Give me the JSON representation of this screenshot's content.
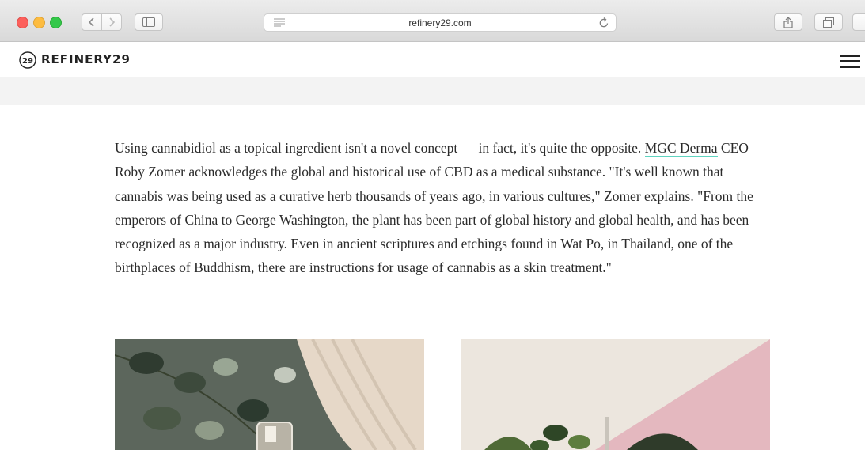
{
  "browser": {
    "url": "refinery29.com",
    "icons": [
      "back-icon",
      "forward-icon",
      "sidebar-icon",
      "reader-icon",
      "reload-icon",
      "share-icon",
      "tabs-icon"
    ]
  },
  "site": {
    "logo_text": "REFINERY29",
    "logo_mark_glyph": "29",
    "menu_icon": "hamburger-menu-icon"
  },
  "article": {
    "para_1a": "Using cannabidiol as a topical ingredient isn't a novel concept — in fact, it's quite the opposite.",
    "link_text": "MGC Derma",
    "para_1b": " CEO Roby Zomer acknowledges the global and historical use of CBD as a medical substance. \"It's well known that cannabis was being used as a curative herb thousands of years ago, in various cultures,\" Zomer explains. \"From the emperors of China to George Washington, the plant has been part of global history and global health, and has been recognized as a major industry. Even in ancient scriptures and etchings found in Wat Po, in Thailand, one of the birthplaces of Buddhism, there are instructions for usage of cannabis as a skin treatment.\"",
    "link_underline_color": "#5fd4c0"
  },
  "colors": {
    "traffic_red": "#fc605c",
    "traffic_yellow": "#fdbc40",
    "traffic_green": "#34c84a"
  }
}
